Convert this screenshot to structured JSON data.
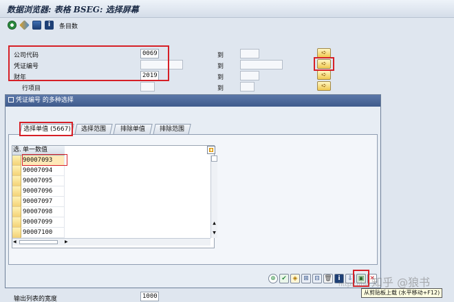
{
  "window": {
    "title": "数据浏览器: 表格 BSEG: 选择屏幕"
  },
  "toolbar": {
    "entries_label": "条目数"
  },
  "selection": {
    "to_label": "到",
    "fields": [
      {
        "label": "公司代码",
        "value": "0069"
      },
      {
        "label": "凭证编号",
        "value": ""
      },
      {
        "label": "财年",
        "value": "2019"
      },
      {
        "label": "行项目",
        "value": ""
      }
    ],
    "output_width": {
      "label": "输出列表的宽度",
      "value": "1000"
    }
  },
  "dialog": {
    "title": "凭证编号 的多种选择",
    "tabs": [
      "选择单值 (5667)",
      "选择范围",
      "排除单值",
      "排除范围"
    ],
    "grid": {
      "col_sel": "选.",
      "col_value": "单一数值",
      "rows": [
        "90007093",
        "90007094",
        "90007095",
        "90007096",
        "90007097",
        "90007098",
        "90007099",
        "90007100"
      ]
    },
    "tooltip": "从剪贴板上载  (水平移动+F12)"
  },
  "watermark": {
    "text": "知乎 @狼书",
    "url": "https://blo..."
  },
  "colors": {
    "highlight": "#d61f26",
    "dialog_title": "#3f5b8c"
  }
}
